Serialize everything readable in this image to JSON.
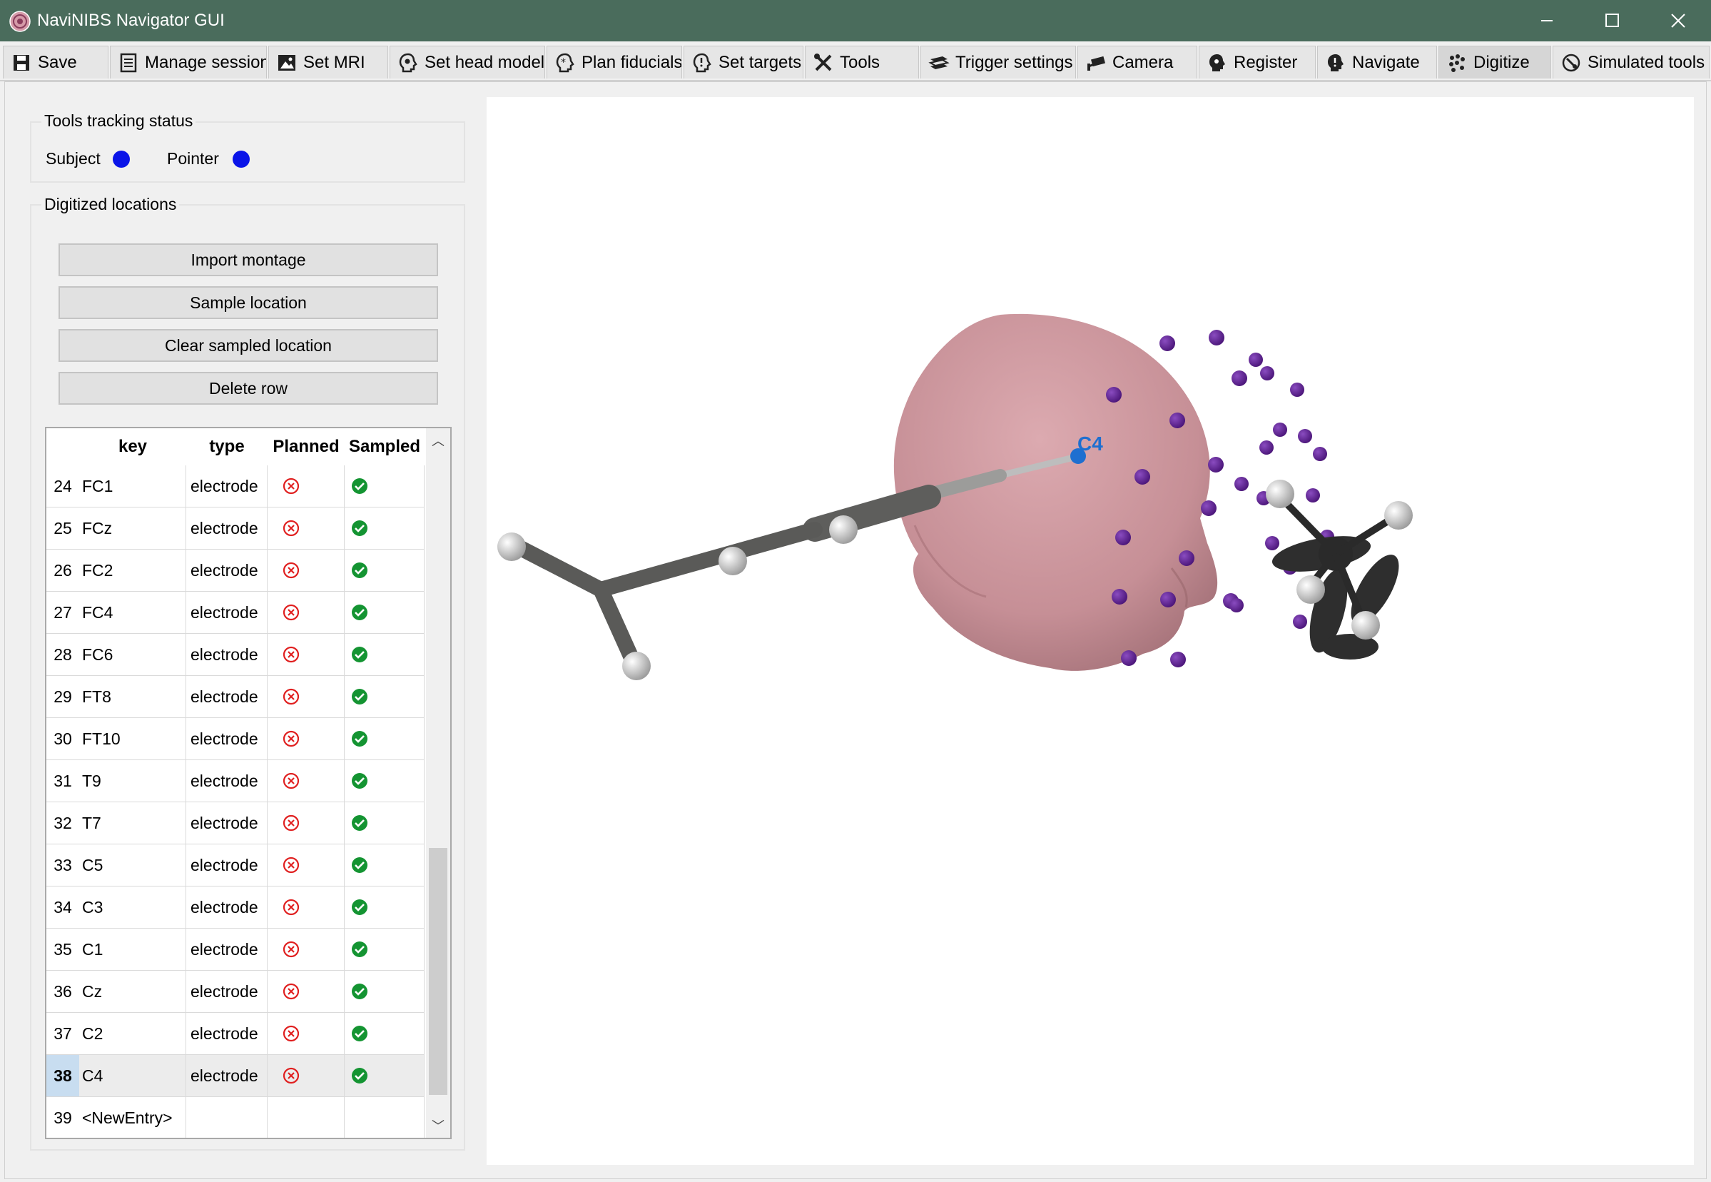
{
  "window": {
    "title": "NaviNIBS Navigator GUI"
  },
  "tabs": [
    {
      "label": "Save",
      "icon": "save-icon"
    },
    {
      "label": "Manage session",
      "icon": "document-icon"
    },
    {
      "label": "Set MRI",
      "icon": "image-icon"
    },
    {
      "label": "Set head model",
      "icon": "head-gear-icon"
    },
    {
      "label": "Plan fiducials",
      "icon": "head-asterisk-icon"
    },
    {
      "label": "Set targets",
      "icon": "head-target-icon"
    },
    {
      "label": "Tools",
      "icon": "tools-icon"
    },
    {
      "label": "Trigger settings",
      "icon": "trigger-icon"
    },
    {
      "label": "Camera",
      "icon": "camera-icon"
    },
    {
      "label": "Register",
      "icon": "head-register-icon"
    },
    {
      "label": "Navigate",
      "icon": "head-navigate-icon"
    },
    {
      "label": "Digitize",
      "icon": "dots-icon"
    },
    {
      "label": "Simulated tools",
      "icon": "simulated-icon"
    }
  ],
  "active_tab": "Digitize",
  "tracking": {
    "title": "Tools tracking status",
    "subject_label": "Subject",
    "pointer_label": "Pointer",
    "status_color": "#0a14e8"
  },
  "digitized": {
    "title": "Digitized locations",
    "buttons": {
      "import": "Import montage",
      "sample": "Sample location",
      "clear": "Clear sampled location",
      "delete": "Delete row"
    }
  },
  "table": {
    "headers": {
      "key": "key",
      "type": "type",
      "planned": "Planned",
      "sampled": "Sampled"
    },
    "rows": [
      {
        "num": "24",
        "key": "FC1",
        "type": "electrode",
        "planned": false,
        "sampled": true
      },
      {
        "num": "25",
        "key": "FCz",
        "type": "electrode",
        "planned": false,
        "sampled": true
      },
      {
        "num": "26",
        "key": "FC2",
        "type": "electrode",
        "planned": false,
        "sampled": true
      },
      {
        "num": "27",
        "key": "FC4",
        "type": "electrode",
        "planned": false,
        "sampled": true
      },
      {
        "num": "28",
        "key": "FC6",
        "type": "electrode",
        "planned": false,
        "sampled": true
      },
      {
        "num": "29",
        "key": "FT8",
        "type": "electrode",
        "planned": false,
        "sampled": true
      },
      {
        "num": "30",
        "key": "FT10",
        "type": "electrode",
        "planned": false,
        "sampled": true
      },
      {
        "num": "31",
        "key": "T9",
        "type": "electrode",
        "planned": false,
        "sampled": true
      },
      {
        "num": "32",
        "key": "T7",
        "type": "electrode",
        "planned": false,
        "sampled": true
      },
      {
        "num": "33",
        "key": "C5",
        "type": "electrode",
        "planned": false,
        "sampled": true
      },
      {
        "num": "34",
        "key": "C3",
        "type": "electrode",
        "planned": false,
        "sampled": true
      },
      {
        "num": "35",
        "key": "C1",
        "type": "electrode",
        "planned": false,
        "sampled": true
      },
      {
        "num": "36",
        "key": "Cz",
        "type": "electrode",
        "planned": false,
        "sampled": true
      },
      {
        "num": "37",
        "key": "C2",
        "type": "electrode",
        "planned": false,
        "sampled": true
      },
      {
        "num": "38",
        "key": "C4",
        "type": "electrode",
        "planned": false,
        "sampled": true,
        "selected": true
      },
      {
        "num": "39",
        "key": "<NewEntry>",
        "type": "",
        "planned": null,
        "sampled": null
      }
    ]
  },
  "scene": {
    "pointer_label": "C4",
    "head_color": "#c9949a",
    "electrode_color": "#5a1f86",
    "pointer_dot_color": "#1e6fd0"
  }
}
